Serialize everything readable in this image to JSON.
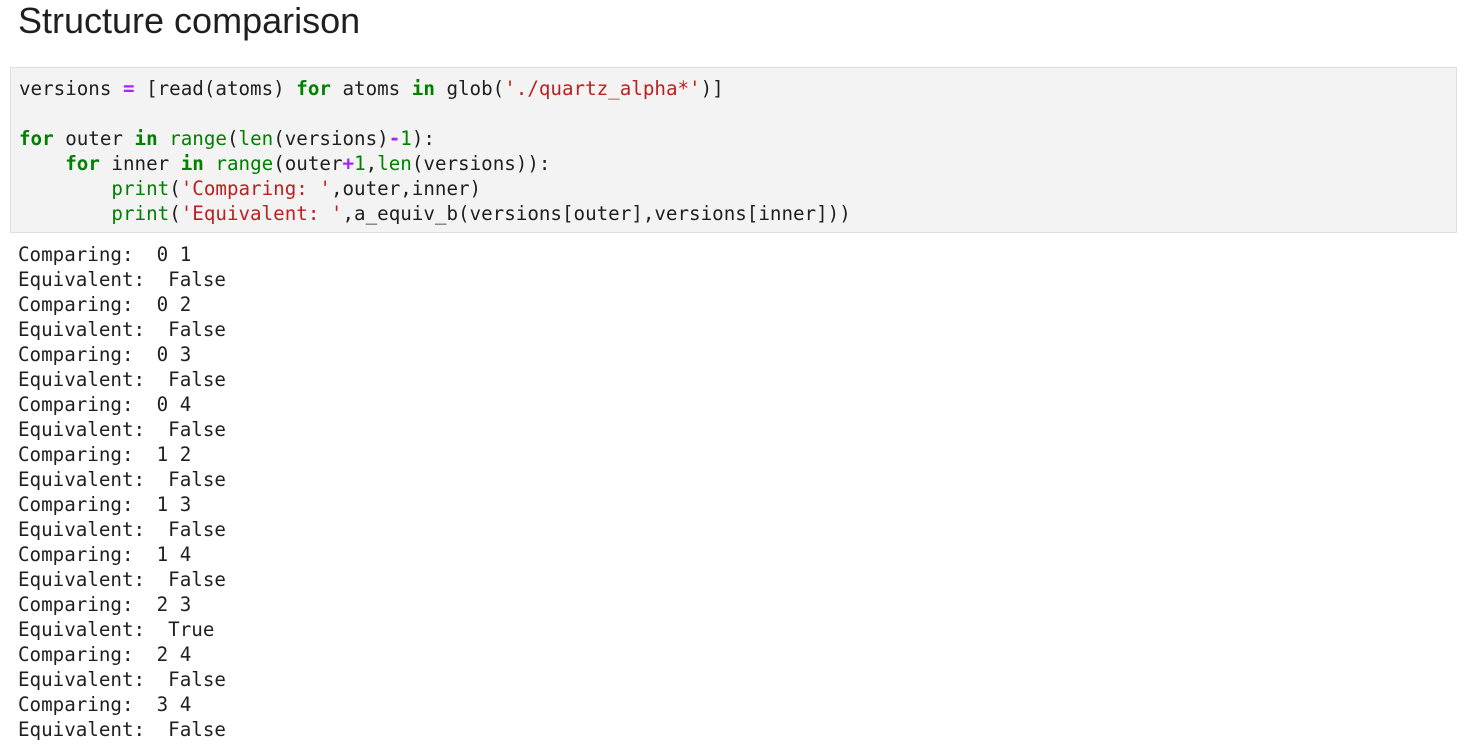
{
  "heading": "Structure comparison",
  "code_cell": {
    "lines": [
      [
        {
          "text": "versions ",
          "cls": ""
        },
        {
          "text": "=",
          "cls": "op"
        },
        {
          "text": " [read(atoms) ",
          "cls": ""
        },
        {
          "text": "for",
          "cls": "kw"
        },
        {
          "text": " atoms ",
          "cls": ""
        },
        {
          "text": "in",
          "cls": "kw"
        },
        {
          "text": " glob(",
          "cls": ""
        },
        {
          "text": "'./quartz_alpha*'",
          "cls": "st"
        },
        {
          "text": ")]",
          "cls": ""
        }
      ],
      [],
      [
        {
          "text": "for",
          "cls": "kw"
        },
        {
          "text": " outer ",
          "cls": ""
        },
        {
          "text": "in",
          "cls": "kw"
        },
        {
          "text": " ",
          "cls": ""
        },
        {
          "text": "range",
          "cls": "bi"
        },
        {
          "text": "(",
          "cls": ""
        },
        {
          "text": "len",
          "cls": "bi"
        },
        {
          "text": "(versions)",
          "cls": ""
        },
        {
          "text": "-",
          "cls": "op"
        },
        {
          "text": "1",
          "cls": "nu"
        },
        {
          "text": "):",
          "cls": ""
        }
      ],
      [
        {
          "text": "    ",
          "cls": ""
        },
        {
          "text": "for",
          "cls": "kw"
        },
        {
          "text": " inner ",
          "cls": ""
        },
        {
          "text": "in",
          "cls": "kw"
        },
        {
          "text": " ",
          "cls": ""
        },
        {
          "text": "range",
          "cls": "bi"
        },
        {
          "text": "(outer",
          "cls": ""
        },
        {
          "text": "+",
          "cls": "op"
        },
        {
          "text": "1",
          "cls": "nu"
        },
        {
          "text": ",",
          "cls": ""
        },
        {
          "text": "len",
          "cls": "bi"
        },
        {
          "text": "(versions)):",
          "cls": ""
        }
      ],
      [
        {
          "text": "        ",
          "cls": ""
        },
        {
          "text": "print",
          "cls": "bi"
        },
        {
          "text": "(",
          "cls": ""
        },
        {
          "text": "'Comparing: '",
          "cls": "st"
        },
        {
          "text": ",outer,inner)",
          "cls": ""
        }
      ],
      [
        {
          "text": "        ",
          "cls": ""
        },
        {
          "text": "print",
          "cls": "bi"
        },
        {
          "text": "(",
          "cls": ""
        },
        {
          "text": "'Equivalent: '",
          "cls": "st"
        },
        {
          "text": ",a_equiv_b(versions[outer],versions[inner]))",
          "cls": ""
        }
      ]
    ]
  },
  "output": {
    "lines": [
      "Comparing:  0 1",
      "Equivalent:  False",
      "Comparing:  0 2",
      "Equivalent:  False",
      "Comparing:  0 3",
      "Equivalent:  False",
      "Comparing:  0 4",
      "Equivalent:  False",
      "Comparing:  1 2",
      "Equivalent:  False",
      "Comparing:  1 3",
      "Equivalent:  False",
      "Comparing:  1 4",
      "Equivalent:  False",
      "Comparing:  2 3",
      "Equivalent:  True",
      "Comparing:  2 4",
      "Equivalent:  False",
      "Comparing:  3 4",
      "Equivalent:  False"
    ]
  }
}
